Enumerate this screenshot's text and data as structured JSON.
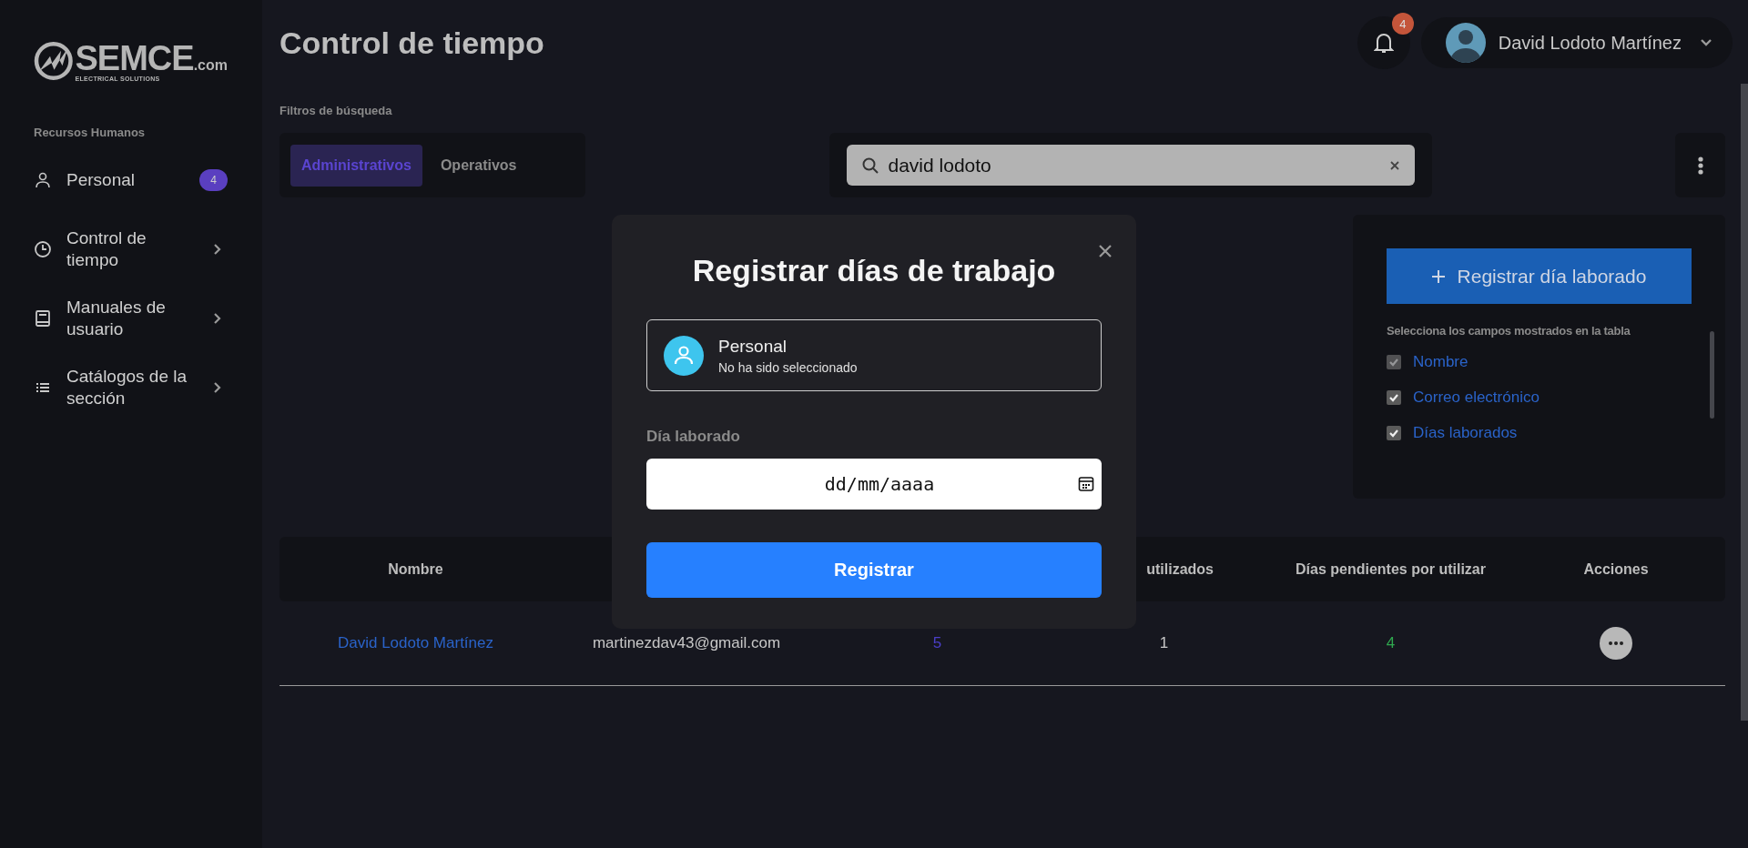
{
  "sidebar": {
    "logo": {
      "name": "SEMCE",
      "domain": ".com",
      "tagline": "ELECTRICAL SOLUTIONS"
    },
    "section": "Recursos Humanos",
    "items": [
      {
        "kind": "person",
        "label": "Personal",
        "badge": "4",
        "expandable": false
      },
      {
        "kind": "clock",
        "label": "Control de tiempo",
        "expandable": true
      },
      {
        "kind": "book",
        "label": "Manuales de usuario",
        "expandable": true
      },
      {
        "kind": "list",
        "label": "Catálogos de la sección",
        "expandable": true
      }
    ]
  },
  "header": {
    "title": "Control de tiempo",
    "notifications": "4",
    "user": "David Lodoto Martínez"
  },
  "filters": {
    "label": "Filtros de búsqueda",
    "tabs": [
      {
        "label": "Administrativos",
        "selected": true
      },
      {
        "label": "Operativos",
        "selected": false
      }
    ],
    "search": {
      "value": "david lodoto"
    }
  },
  "panel": {
    "button": "Registrar día laborado",
    "fields_label": "Selecciona los campos mostrados en la tabla",
    "fields": [
      {
        "label": "Nombre",
        "checked": true,
        "disabled": true
      },
      {
        "label": "Correo electrónico",
        "checked": true,
        "disabled": false
      },
      {
        "label": "Días laborados",
        "checked": true,
        "disabled": false
      }
    ]
  },
  "table": {
    "columns": [
      "Nombre",
      null,
      null,
      "utilizados",
      "Días pendientes por utilizar",
      "Acciones"
    ],
    "rows": [
      {
        "name": "David Lodoto Martínez",
        "email": "martinezdav43@gmail.com",
        "worked": "5",
        "used": "1",
        "pending": "4"
      }
    ]
  },
  "modal": {
    "title": "Registrar días de trabajo",
    "person_label": "Personal",
    "person_status": "No ha sido seleccionado",
    "date_label": "Día laborado",
    "date_placeholder": "dd/mm/aaaa",
    "submit": "Registrar"
  }
}
